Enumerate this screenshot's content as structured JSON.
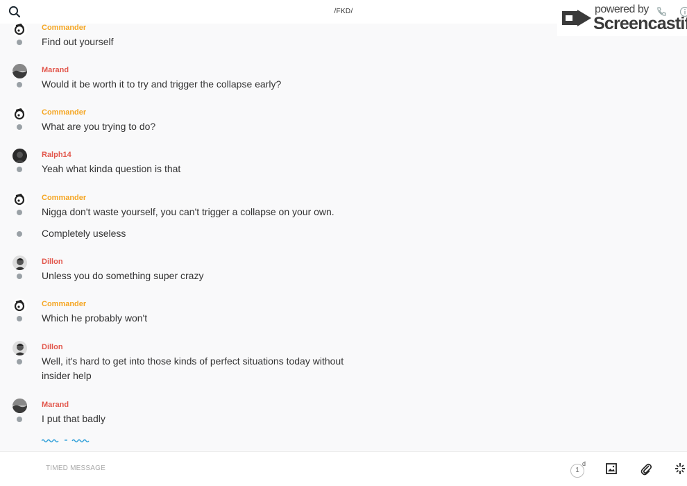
{
  "header": {
    "title": "/FKD/",
    "search_icon": "search-icon"
  },
  "watermark": {
    "powered": "powered by",
    "brand": "Screencastify"
  },
  "colors": {
    "commander": "#f5a623",
    "other_user": "#e2574c",
    "status_dot": "#9aa1a6",
    "typing": "#2f9fd8"
  },
  "messages": [
    {
      "author": "Commander",
      "text": "Find out yourself"
    },
    {
      "author": "Marand",
      "text": "Would it be worth it to try and trigger the collapse early?"
    },
    {
      "author": "Commander",
      "text": "What are you trying to do?"
    },
    {
      "author": "Ralph14",
      "text": "Yeah what kinda question is that"
    },
    {
      "author": "Commander",
      "text": "Nigga don't waste yourself, you can't trigger a collapse on your own."
    },
    {
      "author": "",
      "text": "Completely useless"
    },
    {
      "author": "Dillon",
      "text": "Unless you do something super crazy"
    },
    {
      "author": "Commander",
      "text": "Which he probably won't"
    },
    {
      "author": "Dillon",
      "text": "Well, it's hard to get into those kinds of perfect situations today without",
      "text2": "insider help"
    },
    {
      "author": "Marand",
      "text": "I put that badly"
    }
  ],
  "composer": {
    "placeholder": "TIMED MESSAGE",
    "timer_value": "1",
    "timer_unit": "d"
  }
}
